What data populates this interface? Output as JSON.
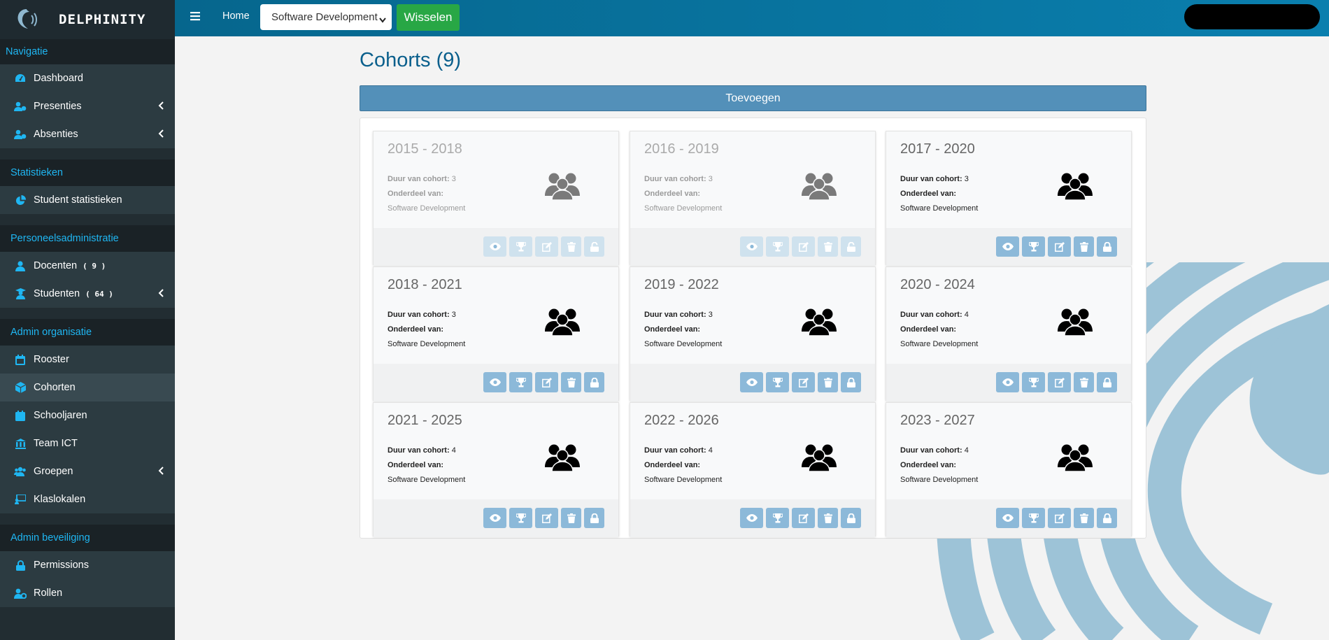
{
  "brand": {
    "name": "DELPHINITY"
  },
  "sidebar": {
    "sections": [
      {
        "title": "Navigatie",
        "items": [
          {
            "label": "Dashboard",
            "icon": "dashboard-icon"
          },
          {
            "label": "Presenties",
            "icon": "user-check-icon",
            "expandable": true
          },
          {
            "label": "Absenties",
            "icon": "user-clock-icon",
            "expandable": true
          }
        ]
      },
      {
        "title": "Statistieken",
        "items": [
          {
            "label": "Student statistieken",
            "icon": "pie-chart-icon"
          }
        ]
      },
      {
        "title": "Personeelsadministratie",
        "items": [
          {
            "label": "Docenten",
            "count": "( 9 )",
            "icon": "user-icon"
          },
          {
            "label": "Studenten",
            "count": "( 64 )",
            "icon": "graduate-icon",
            "expandable": true
          }
        ]
      },
      {
        "title": "Admin organisatie",
        "items": [
          {
            "label": "Rooster",
            "icon": "calendar-icon"
          },
          {
            "label": "Cohorten",
            "icon": "cube-icon",
            "active": true
          },
          {
            "label": "Schooljaren",
            "icon": "calendar-icon"
          },
          {
            "label": "Team ICT",
            "icon": "building-icon"
          },
          {
            "label": "Groepen",
            "icon": "users-icon",
            "expandable": true
          },
          {
            "label": "Klaslokalen",
            "icon": "classroom-icon"
          }
        ]
      },
      {
        "title": "Admin beveiliging",
        "items": [
          {
            "label": "Permissions",
            "icon": "lock-icon"
          },
          {
            "label": "Rollen",
            "icon": "user-cog-icon"
          }
        ]
      }
    ]
  },
  "topbar": {
    "home": "Home",
    "select_value": "Software Development",
    "switch_label": "Wisselen"
  },
  "main": {
    "title": "Cohorts (9)",
    "add_label": "Toevoegen",
    "duration_label": "Duur van cohort:",
    "part_label": "Onderdeel van:",
    "cohorts": [
      {
        "name": "2015 - 2018",
        "duration": "3",
        "part": "Software Development",
        "active": false
      },
      {
        "name": "2016 - 2019",
        "duration": "3",
        "part": "Software Development",
        "active": false
      },
      {
        "name": "2017 - 2020",
        "duration": "3",
        "part": "Software Development",
        "active": true
      },
      {
        "name": "2018 - 2021",
        "duration": "3",
        "part": "Software Development",
        "active": true
      },
      {
        "name": "2019 - 2022",
        "duration": "3",
        "part": "Software Development",
        "active": true
      },
      {
        "name": "2020 - 2024",
        "duration": "4",
        "part": "Software Development",
        "active": true
      },
      {
        "name": "2021 - 2025",
        "duration": "4",
        "part": "Software Development",
        "active": true
      },
      {
        "name": "2022 - 2026",
        "duration": "4",
        "part": "Software Development",
        "active": true
      },
      {
        "name": "2023 - 2027",
        "duration": "4",
        "part": "Software Development",
        "active": true
      }
    ],
    "card_actions": [
      "eye-icon",
      "trophy-icon",
      "edit-icon",
      "trash-icon",
      "lock-icon"
    ]
  },
  "colors": {
    "accent": "#1fb6f2",
    "topbar": "#0a7fae",
    "action": "#8cb9d9",
    "switch": "#28a745"
  }
}
